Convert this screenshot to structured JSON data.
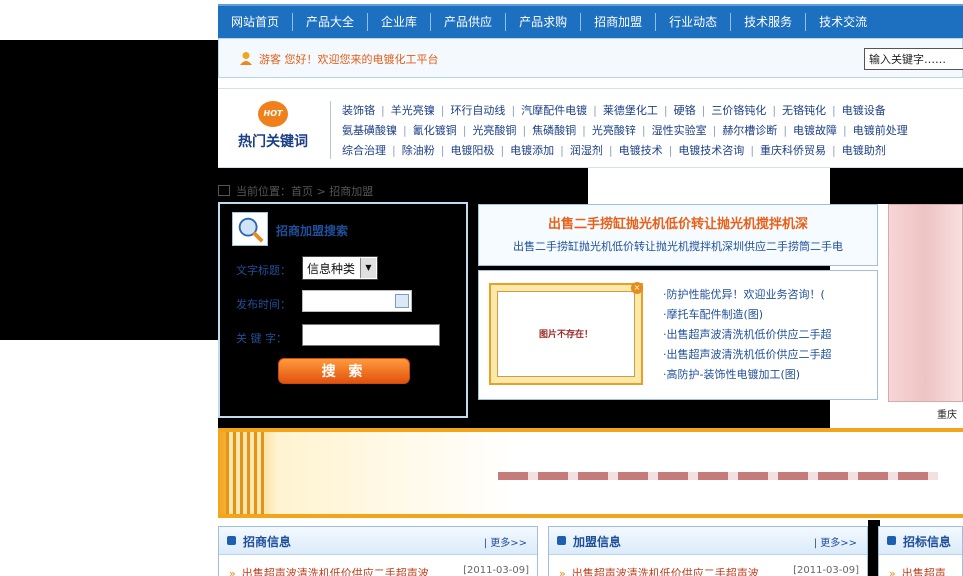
{
  "nav": {
    "items": [
      "网站首页",
      "产品大全",
      "企业库",
      "产品供应",
      "产品求购",
      "招商加盟",
      "行业动态",
      "技术服务",
      "技术交流"
    ]
  },
  "greeting": {
    "text": "游客 您好！欢迎您来的电镀化工平台",
    "search_value": "输入关键字……"
  },
  "hot": {
    "badge": "HOT",
    "title": "热门关键词",
    "rows": [
      [
        "装饰铬",
        "羊光亮镍",
        "环行自动线",
        "汽摩配件电镀",
        "莱德堡化工",
        "硬铬",
        "三价铬钝化",
        "无铬钝化",
        "电镀设备"
      ],
      [
        "氨基磺酸镍",
        "氰化镀铜",
        "光亮酸铜",
        "焦磷酸铜",
        "光亮酸锌",
        "湿性实验室",
        "赫尔槽诊断",
        "电镀故障",
        "电镀前处理"
      ],
      [
        "综合治理",
        "除油粉",
        "电镀阳极",
        "电镀添加",
        "润湿剂",
        "电镀技术",
        "电镀技术咨询",
        "重庆科侨贸易",
        "电镀助剂"
      ]
    ]
  },
  "breadcrumb": "当前位置：首页 > 招商加盟",
  "search": {
    "title": "招商加盟搜索",
    "label_title": "文字标题：",
    "category_value": "信息种类",
    "label_date": "发布时间：",
    "label_keyword": "关 键 字：",
    "button": "搜 索"
  },
  "headline": {
    "main": "出售二手捞缸抛光机低价转让抛光机搅拌机深",
    "sub": "出售二手捞缸抛光机低价转让抛光机搅拌机深圳供应二手捞筒二手电"
  },
  "promo": {
    "image_text": "图片不存在！",
    "items": [
      "·防护性能优异！欢迎业务咨询！(",
      "·摩托车配件制造(图)",
      "·出售超声波清洗机低价供应二手超",
      "·出售超声波清洗机低价供应二手超",
      "·高防护-装饰性电镀加工(图)"
    ]
  },
  "thumb_caption": "重庆",
  "panels": [
    {
      "title": "招商信息",
      "more": "| 更多>>",
      "item": "出售超声波清洗机低价供应二手超声波",
      "date": "[2011-03-09]"
    },
    {
      "title": "加盟信息",
      "more": "| 更多>>",
      "item": "出售超声波清洗机低价供应二手超声波",
      "date": "[2011-03-09]"
    },
    {
      "title": "招标信息",
      "more": "",
      "item": "出售超声",
      "date": ""
    }
  ],
  "colors": {
    "nav_blue": "#1d6fbf",
    "accent_orange": "#e8601a",
    "link_blue": "#1f4f9a"
  }
}
